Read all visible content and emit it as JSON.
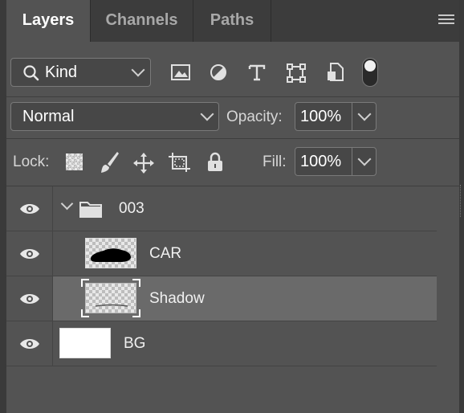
{
  "tabs": [
    {
      "label": "Layers",
      "active": true
    },
    {
      "label": "Channels",
      "active": false
    },
    {
      "label": "Paths",
      "active": false
    }
  ],
  "filter": {
    "kind_label": "Kind",
    "icons": [
      "image-filter-icon",
      "adjustment-filter-icon",
      "type-filter-icon",
      "shape-filter-icon",
      "smart-object-filter-icon",
      "filter-toggle"
    ]
  },
  "blend": {
    "mode": "Normal",
    "opacity_label": "Opacity:",
    "opacity_value": "100%"
  },
  "lock": {
    "label": "Lock:",
    "fill_label": "Fill:",
    "fill_value": "100%"
  },
  "layers": [
    {
      "name": "003",
      "type": "group",
      "visible": true,
      "selected": false
    },
    {
      "name": "CAR",
      "type": "layer",
      "visible": true,
      "selected": false
    },
    {
      "name": "Shadow",
      "type": "layer",
      "visible": true,
      "selected": true
    },
    {
      "name": "BG",
      "type": "layer",
      "visible": true,
      "selected": false
    }
  ],
  "colors": {
    "panel_bg": "#535353",
    "tab_bar": "#3c3c3c",
    "selected_row": "#6a6a6a"
  }
}
